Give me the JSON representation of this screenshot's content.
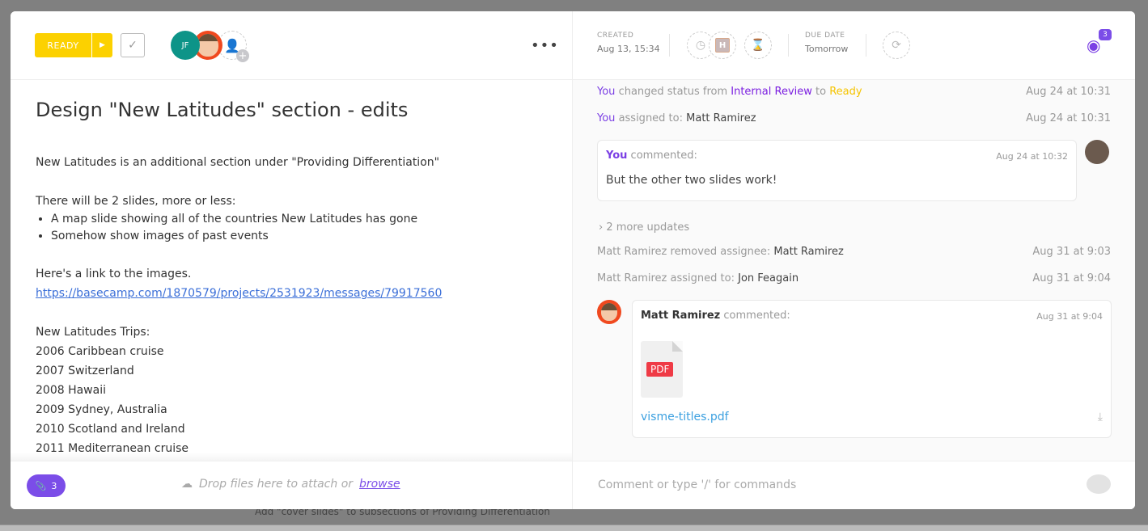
{
  "background": {
    "row_text": "Add \"cover slides\" to subsections of Providing Differentiation"
  },
  "header": {
    "status_label": "READY",
    "status_color": "#fcd100",
    "assignees": [
      {
        "initials": "JF",
        "color": "#0d9488"
      },
      {
        "name": "Matt Ramirez"
      }
    ],
    "created_label": "CREATED",
    "created_value": "Aug 13, 15:34",
    "due_label": "DUE DATE",
    "due_value": "Tomorrow",
    "priority_letter": "H",
    "watchers_count": "3"
  },
  "task": {
    "title": "Design \"New Latitudes\" section - edits",
    "intro": "New Latitudes is an additional section under \"Providing Differentiation\"",
    "slides_heading": "There will be 2 slides, more or less:",
    "bullets": [
      "A map slide showing all of the countries New Latitudes has gone",
      "Somehow show images of past events"
    ],
    "link_intro": "Here's a link to the images.",
    "link": "https://basecamp.com/1870579/projects/2531923/messages/79917560",
    "trips_heading": "New Latitudes Trips:",
    "trips": [
      "2006 Caribbean cruise",
      "2007 Switzerland",
      "2008 Hawaii",
      "2009 Sydney, Australia",
      "2010 Scotland and Ireland",
      "2011 Mediterranean cruise"
    ]
  },
  "footer": {
    "attachments_count": "3",
    "drop_text": "Drop files here to attach or",
    "browse": "browse",
    "comment_placeholder": "Comment or type '/' for commands"
  },
  "activity": {
    "a1": {
      "who": "You",
      "text": "changed status from",
      "from": "Internal Review",
      "to_word": "to",
      "to": "Ready",
      "time": "Aug 24 at 10:31"
    },
    "a2": {
      "who": "You",
      "text": "assigned to:",
      "target": "Matt Ramirez",
      "time": "Aug 24 at 10:31"
    },
    "c1": {
      "who": "You",
      "action": "commented:",
      "time": "Aug 24 at 10:32",
      "body": "But the other two slides work!"
    },
    "more": "2 more updates",
    "a3": {
      "who": "Matt Ramirez",
      "text": "removed assignee:",
      "target": "Matt Ramirez",
      "time": "Aug 31 at 9:03"
    },
    "a4": {
      "who": "Matt Ramirez",
      "text": "assigned to:",
      "target": "Jon Feagain",
      "time": "Aug 31 at 9:04"
    },
    "c2": {
      "who": "Matt Ramirez",
      "action": "commented:",
      "time": "Aug 31 at 9:04",
      "file_type": "PDF",
      "file_name": "visme-titles.pdf"
    }
  }
}
